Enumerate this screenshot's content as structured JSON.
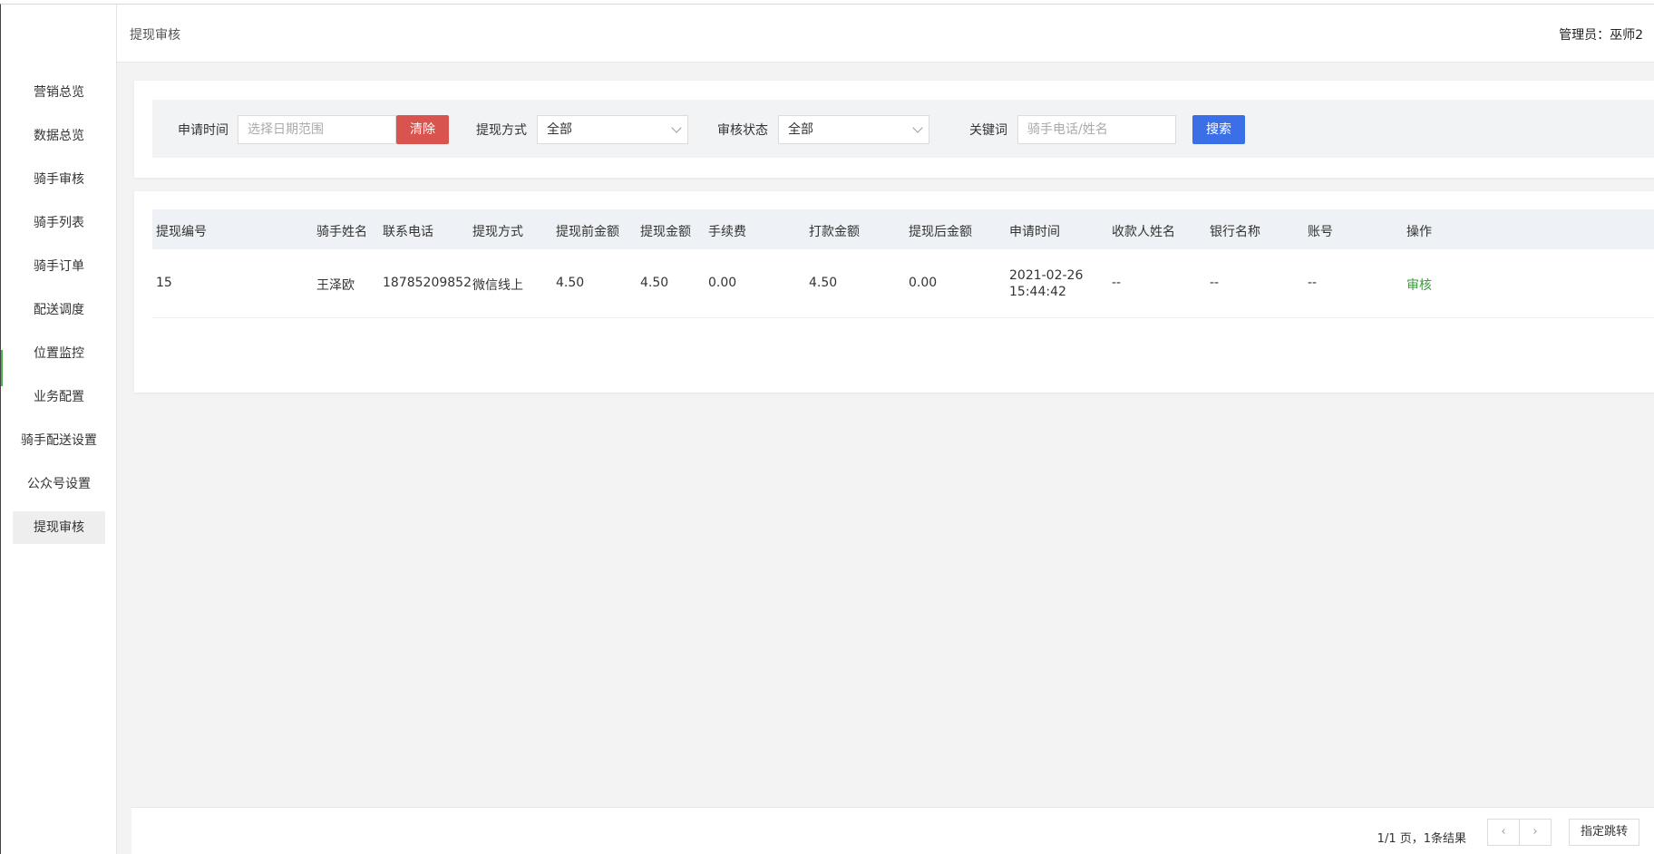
{
  "header": {
    "title": "提现审核",
    "admin": "管理员：巫师2"
  },
  "sidebar": {
    "items": [
      {
        "label": "营销总览"
      },
      {
        "label": "数据总览"
      },
      {
        "label": "骑手审核"
      },
      {
        "label": "骑手列表"
      },
      {
        "label": "骑手订单"
      },
      {
        "label": "配送调度"
      },
      {
        "label": "位置监控"
      },
      {
        "label": "业务配置"
      },
      {
        "label": "骑手配送设置"
      },
      {
        "label": "公众号设置"
      },
      {
        "label": "提现审核"
      }
    ],
    "active_index": 10
  },
  "filters": {
    "time_label": "申请时间",
    "date_placeholder": "选择日期范围",
    "clear_label": "清除",
    "method_label": "提现方式",
    "method_value": "全部",
    "status_label": "审核状态",
    "status_value": "全部",
    "keyword_label": "关键词",
    "keyword_placeholder": "骑手电话/姓名",
    "search_label": "搜索"
  },
  "table": {
    "columns": [
      "提现编号",
      "骑手姓名",
      "联系电话",
      "提现方式",
      "提现前金额",
      "提现金额",
      "手续费",
      "打款金额",
      "提现后金额",
      "申请时间",
      "收款人姓名",
      "银行名称",
      "账号",
      "操作"
    ],
    "rows": [
      {
        "id": "15",
        "name": "王泽欧",
        "phone": "18785209852",
        "method": "微信线上",
        "before": "4.50",
        "amount": "4.50",
        "fee": "0.00",
        "paid": "4.50",
        "after": "0.00",
        "date": "2021-02-26",
        "time": "15:44:42",
        "payee": "--",
        "bank": "--",
        "account": "--",
        "action": "审核"
      }
    ]
  },
  "pagination": {
    "info": "1/1 页，1条结果",
    "prev": "‹",
    "next": "›",
    "jump_label": "指定跳转"
  },
  "colors": {
    "clear_button": "#d9534f",
    "search_button": "#3a6fe8",
    "action_link": "#3a9c3a",
    "sidebar_accent": "#4cae4c"
  }
}
